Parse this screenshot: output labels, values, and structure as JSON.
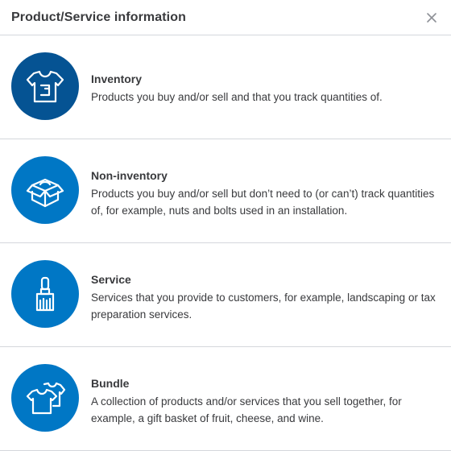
{
  "dialog": {
    "title": "Product/Service information",
    "close_icon": "close-icon"
  },
  "types": [
    {
      "name": "Inventory",
      "description": "Products you buy and/or sell and that you track quantities of.",
      "icon": "t-shirt-icon",
      "icon_color": "#055393"
    },
    {
      "name": "Non-inventory",
      "description": "Products you buy and/or sell but don’t need to (or can’t) track quantities of, for example, nuts and bolts used in an installation.",
      "icon": "open-box-icon",
      "icon_color": "#0077c5"
    },
    {
      "name": "Service",
      "description": "Services that you provide to customers, for example, landscaping or tax preparation services.",
      "icon": "paintbrush-icon",
      "icon_color": "#0077c5"
    },
    {
      "name": "Bundle",
      "description": "A collection of products and/or services that you sell together, for example, a gift basket of fruit, cheese, and wine.",
      "icon": "two-shirts-icon",
      "icon_color": "#0077c5"
    }
  ]
}
